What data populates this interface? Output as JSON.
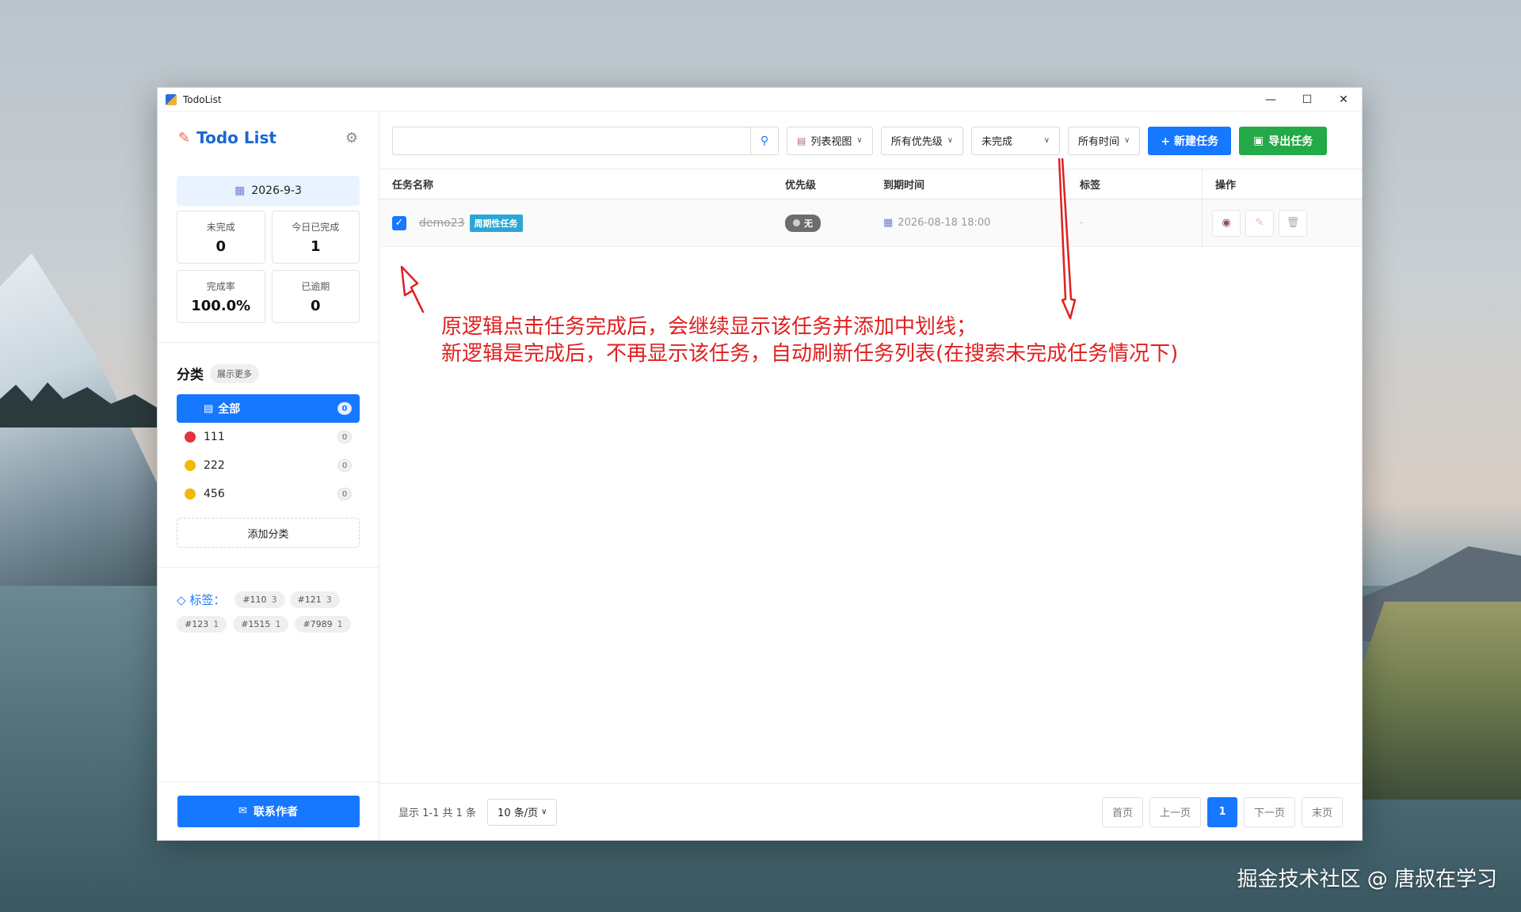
{
  "window": {
    "title": "TodoList",
    "minimize": "—",
    "maximize": "☐",
    "close": "✕"
  },
  "sidebar": {
    "brand": "Todo List",
    "date": "2026-9-3",
    "stats": [
      {
        "label": "未完成",
        "value": "0"
      },
      {
        "label": "今日已完成",
        "value": "1"
      },
      {
        "label": "完成率",
        "value": "100.0%"
      },
      {
        "label": "已逾期",
        "value": "0"
      }
    ],
    "category_title": "分类",
    "show_more": "展示更多",
    "categories": [
      {
        "label": "全部",
        "count": "0",
        "color": ""
      },
      {
        "label": "111",
        "count": "0",
        "color": "#e0343f"
      },
      {
        "label": "222",
        "count": "0",
        "color": "#f5b800"
      },
      {
        "label": "456",
        "count": "0",
        "color": "#f5b800"
      }
    ],
    "add_category": "添加分类",
    "tags_title": "标签：",
    "tags": [
      {
        "name": "#110",
        "count": "3"
      },
      {
        "name": "#121",
        "count": "3"
      },
      {
        "name": "#123",
        "count": "1"
      },
      {
        "name": "#1515",
        "count": "1"
      },
      {
        "name": "#7989",
        "count": "1"
      }
    ],
    "contact": "联系作者"
  },
  "toolbar": {
    "search_placeholder": "",
    "view": "列表视图",
    "priority": "所有优先级",
    "status": "未完成",
    "time": "所有时间",
    "new_task": "+ 新建任务",
    "export": "导出任务"
  },
  "table": {
    "headers": [
      "任务名称",
      "优先级",
      "到期时间",
      "标签",
      "操作"
    ],
    "rows": [
      {
        "name": "demo23",
        "badge": "周期性任务",
        "priority": "无",
        "due": "2026-08-18 18:00",
        "tags": "-"
      }
    ]
  },
  "annotation": {
    "line1": "原逻辑点击任务完成后，会继续显示该任务并添加中划线；",
    "line2": "新逻辑是完成后，不再显示该任务，自动刷新任务列表(在搜索未完成任务情况下)",
    "color": "#e02020"
  },
  "footer": {
    "summary": "显示 1-1 共 1 条",
    "page_size": "10 条/页",
    "first": "首页",
    "prev": "上一页",
    "current": "1",
    "next": "下一页",
    "last": "末页"
  },
  "watermark": "掘金技术社区 @ 唐叔在学习",
  "colors": {
    "primary": "#1677ff",
    "success": "#23a947",
    "badge": "#2aa7d6"
  }
}
